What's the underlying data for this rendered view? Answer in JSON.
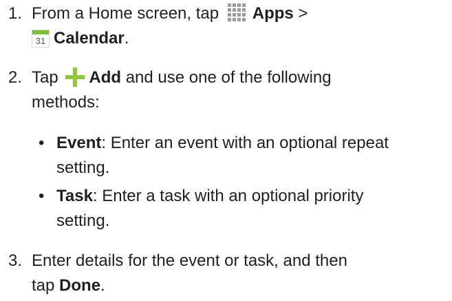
{
  "steps": [
    {
      "number": "1.",
      "text_a": "From a Home screen, tap",
      "apps_label": "Apps",
      "separator": ">",
      "calendar_day": "31",
      "calendar_label": "Calendar",
      "end_punct": "."
    },
    {
      "number": "2.",
      "text_a": "Tap",
      "add_label": "Add",
      "text_b": "and use one of the following",
      "text_c": "methods:",
      "bullets": [
        {
          "term": "Event",
          "line1": ": Enter an event with an optional repeat",
          "line2": "setting."
        },
        {
          "term": "Task",
          "line1": ": Enter a task with an optional priority",
          "line2": "setting."
        }
      ]
    },
    {
      "number": "3.",
      "line1": "Enter details for the event or task, and then",
      "text_a": "tap",
      "done_label": "Done",
      "end_punct": "."
    }
  ],
  "icons": {
    "apps": "apps-grid-icon",
    "calendar": "calendar-icon",
    "add": "add-plus-icon",
    "accent_green": "#8dc63f",
    "apps_gray": "#9b9b9b"
  }
}
